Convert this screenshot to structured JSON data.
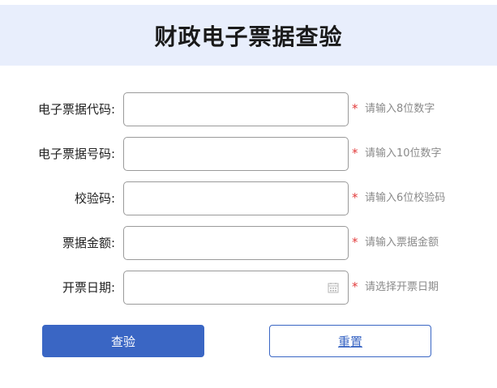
{
  "header": {
    "title": "财政电子票据查验"
  },
  "form": {
    "fields": [
      {
        "label": "电子票据代码:",
        "value": "",
        "hint": "请输入8位数字"
      },
      {
        "label": "电子票据号码:",
        "value": "",
        "hint": "请输入10位数字"
      },
      {
        "label": "校验码:",
        "value": "",
        "hint": "请输入6位校验码"
      },
      {
        "label": "票据金额:",
        "value": "",
        "hint": "请输入票据金额"
      },
      {
        "label": "开票日期:",
        "value": "",
        "hint": "请选择开票日期",
        "icon": "calendar-icon"
      }
    ],
    "required_mark": "*"
  },
  "actions": {
    "query_label": "查验",
    "reset_label": "重置"
  },
  "colors": {
    "header_bg": "#e8eefc",
    "primary": "#3a66c4",
    "required": "#e23b3b",
    "hint": "#8a8a8a"
  }
}
